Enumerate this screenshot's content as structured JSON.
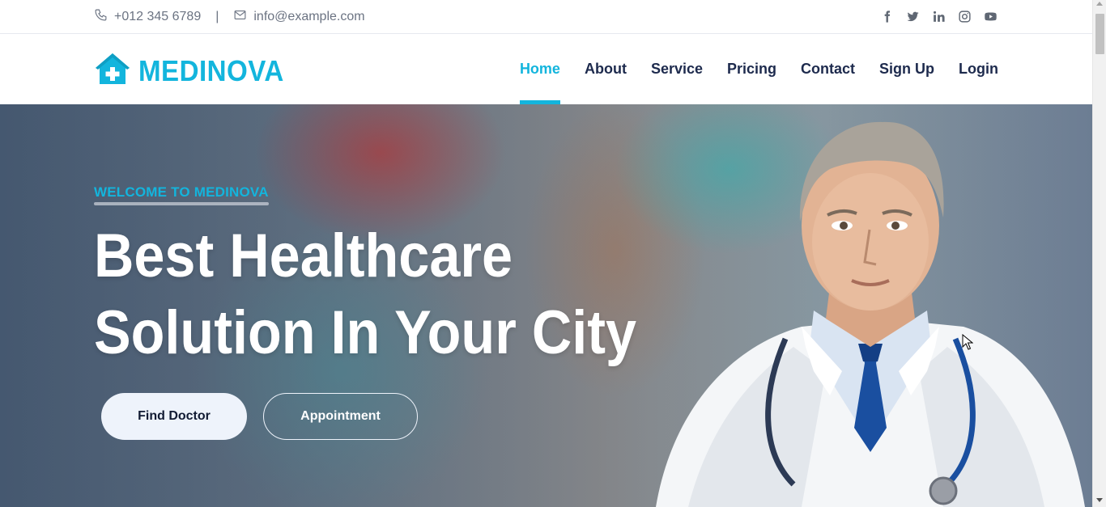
{
  "topbar": {
    "phone": "+012 345 6789",
    "separator": "|",
    "email": "info@example.com",
    "social": [
      "facebook-icon",
      "twitter-icon",
      "linkedin-icon",
      "instagram-icon",
      "youtube-icon"
    ]
  },
  "brand": {
    "name": "MEDINOVA",
    "logo_icon": "house-medical-icon",
    "color": "#13b5dd"
  },
  "nav": {
    "items": [
      {
        "label": "Home",
        "active": true
      },
      {
        "label": "About"
      },
      {
        "label": "Service"
      },
      {
        "label": "Pricing"
      },
      {
        "label": "Contact"
      },
      {
        "label": "Sign Up"
      },
      {
        "label": "Login"
      }
    ]
  },
  "hero": {
    "subtitle": "WELCOME TO MEDINOVA",
    "headline_line1": "Best Healthcare",
    "headline_line2": "Solution In Your City",
    "primary_button": "Find Doctor",
    "secondary_button": "Appointment"
  },
  "colors": {
    "accent": "#13b5dd",
    "text_dark": "#1d2a4d",
    "muted": "#6b7382"
  }
}
